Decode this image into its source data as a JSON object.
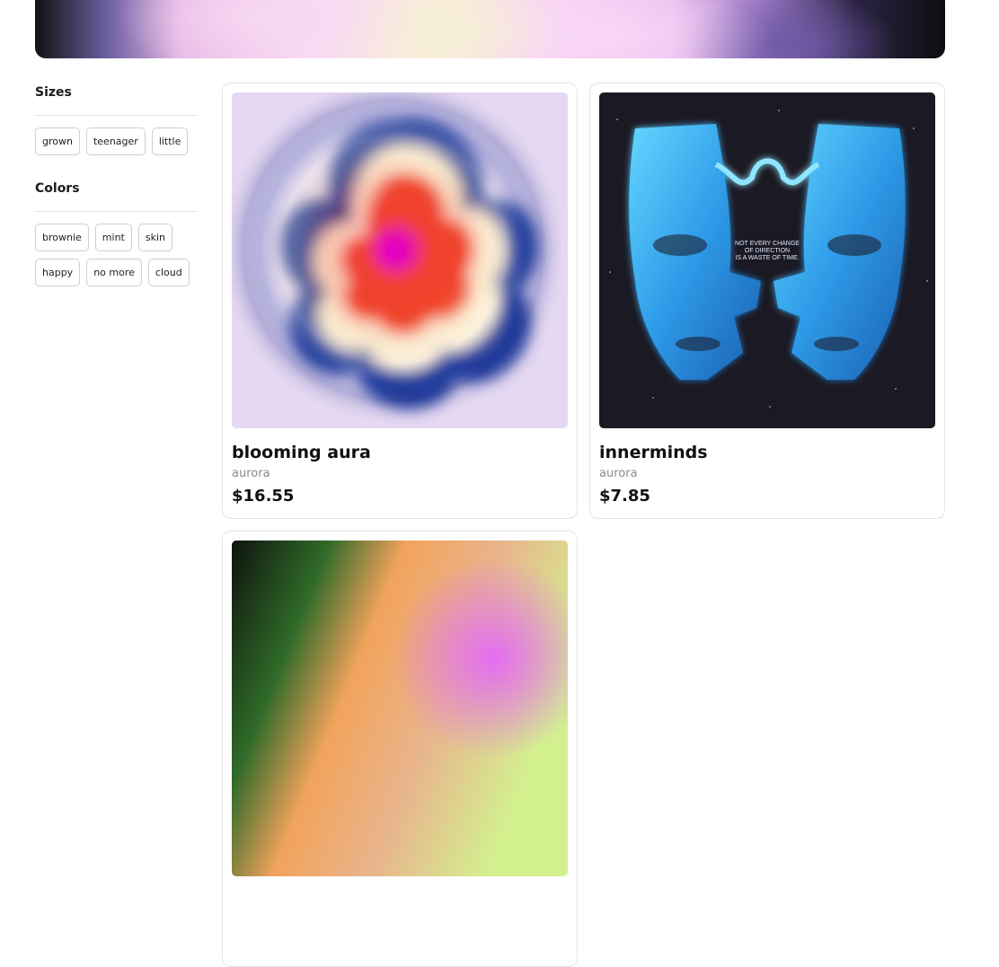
{
  "filters": {
    "sizes": {
      "title": "Sizes",
      "options": [
        "grown",
        "teenager",
        "little"
      ]
    },
    "colors": {
      "title": "Colors",
      "options": [
        "brownie",
        "mint",
        "skin",
        "happy",
        "no more",
        "cloud"
      ]
    }
  },
  "products": [
    {
      "name": "blooming aura",
      "brand": "aurora",
      "price": "$16.55"
    },
    {
      "name": "innerminds",
      "brand": "aurora",
      "price": "$7.85",
      "image_text": "NOT EVERY CHANGE OF DIRECTION IS A WASTE OF TIME."
    },
    {
      "name": "",
      "brand": "",
      "price": ""
    }
  ]
}
